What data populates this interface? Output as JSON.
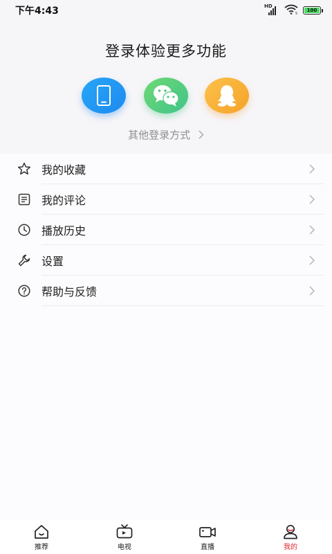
{
  "status": {
    "time": "下午4:43",
    "hd": "HD",
    "battery": "100",
    "battery_level": 1.0
  },
  "login": {
    "title": "登录体验更多功能",
    "other": "其他登录方式",
    "methods": [
      {
        "icon": "phone-icon",
        "color": "#1e8af2"
      },
      {
        "icon": "wechat-icon",
        "color": "#40c48a"
      },
      {
        "icon": "qq-icon",
        "color": "#f5a32a"
      }
    ]
  },
  "menu": {
    "items": [
      {
        "label": "我的收藏",
        "icon": "star-icon"
      },
      {
        "label": "我的评论",
        "icon": "comment-icon"
      },
      {
        "label": "播放历史",
        "icon": "clock-icon"
      },
      {
        "label": "设置",
        "icon": "wrench-icon"
      },
      {
        "label": "帮助与反馈",
        "icon": "help-icon"
      }
    ]
  },
  "nav": {
    "items": [
      {
        "label": "推荐",
        "icon": "home-icon",
        "active": false
      },
      {
        "label": "电视",
        "icon": "tv-icon",
        "active": false
      },
      {
        "label": "直播",
        "icon": "camera-icon",
        "active": false
      },
      {
        "label": "我的",
        "icon": "profile-icon",
        "active": true
      }
    ],
    "active_color": "#e0252c"
  }
}
